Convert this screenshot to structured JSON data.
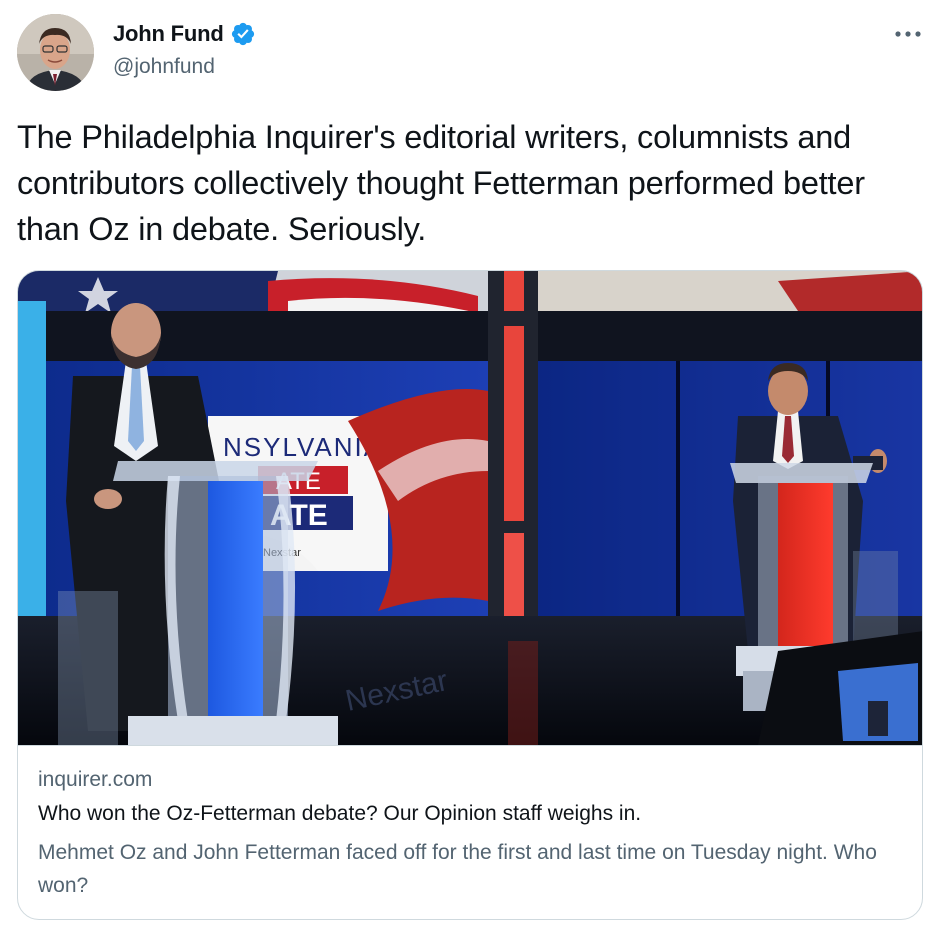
{
  "author": {
    "display_name": "John Fund",
    "handle": "@johnfund",
    "verified": true,
    "avatar_icon": "profile-photo"
  },
  "more_icon": "more-horizontal-icon",
  "tweet": {
    "text": "The Philadelphia Inquirer's editorial writers, columnists and contributors collectively thought Fetterman performed better than Oz in debate. Seriously."
  },
  "card": {
    "image_text": {
      "banner_line1": "NSYLVANIA",
      "banner_line2": "ATE",
      "banner_line3": "ATE",
      "banner_small": "Nexstar",
      "floor_logo": "Nexstar"
    },
    "domain": "inquirer.com",
    "title": "Who won the Oz-Fetterman debate? Our Opinion staff weighs in.",
    "description": "Mehmet Oz and John Fetterman faced off for the first and last time on Tuesday night. Who won?"
  },
  "colors": {
    "verified_blue": "#1d9bf0",
    "secondary_text": "#536471",
    "border": "#cfd9de"
  }
}
